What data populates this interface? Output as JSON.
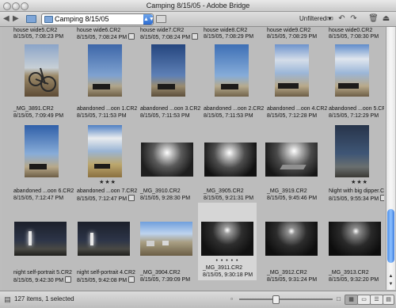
{
  "window": {
    "title": "Camping 8/15/05 - Adobe Bridge"
  },
  "toolbar": {
    "back_icon": "back-arrow-icon",
    "forward_icon": "forward-arrow-icon",
    "folder_path": "Camping 8/15/05",
    "filter_label": "Unfiltered"
  },
  "content": {
    "top_row_partial": [
      {
        "name": "house wide5.CR2",
        "date": "8/15/05, 7:08:23 PM",
        "badge": false
      },
      {
        "name": "house wide6.CR2",
        "date": "8/15/05, 7:08:24 PM",
        "badge": true
      },
      {
        "name": "house wide7.CR2",
        "date": "8/15/05, 7:08:24 PM",
        "badge": true
      },
      {
        "name": "house wide8.CR2",
        "date": "8/15/05, 7:08:29 PM",
        "badge": false
      },
      {
        "name": "house wide9.CR2",
        "date": "8/15/05, 7:08:29 PM",
        "badge": false
      },
      {
        "name": "house wide0.CR2",
        "date": "8/15/05, 7:08:30 PM",
        "badge": false
      }
    ],
    "row2": [
      {
        "name": "_MG_3891.CR2",
        "date": "8/15/05, 7:09:49 PM",
        "badge": false,
        "stars": ""
      },
      {
        "name": "abandoned ...oon 1.CR2",
        "date": "8/15/05, 7:11:53 PM",
        "badge": false,
        "stars": ""
      },
      {
        "name": "abandoned ...oon 3.CR2",
        "date": "8/15/05, 7:11:53 PM",
        "badge": false,
        "stars": ""
      },
      {
        "name": "abandoned ...oon 2.CR2",
        "date": "8/15/05, 7:11:53 PM",
        "badge": false,
        "stars": ""
      },
      {
        "name": "abandoned ...oon 4.CR2",
        "date": "8/15/05, 7:12:28 PM",
        "badge": false,
        "stars": ""
      },
      {
        "name": "abandoned ...oon 5.CR2",
        "date": "8/15/05, 7:12:29 PM",
        "badge": false,
        "stars": ""
      }
    ],
    "row3": [
      {
        "name": "abandoned ...oon 6.CR2",
        "date": "8/15/05, 7:12:47 PM",
        "badge": false,
        "stars": ""
      },
      {
        "name": "abandoned ...oon 7.CR2",
        "date": "8/15/05, 7:12:47 PM",
        "badge": true,
        "stars": "★★★"
      },
      {
        "name": "_MG_3910.CR2",
        "date": "8/15/05, 9:28:30 PM",
        "badge": false,
        "stars": ""
      },
      {
        "name": "_MG_3905.CR2",
        "date": "8/15/05, 9:21:31 PM",
        "badge": false,
        "stars": ""
      },
      {
        "name": "_MG_3919.CR2",
        "date": "8/15/05, 9:45:46 PM",
        "badge": false,
        "stars": ""
      },
      {
        "name": "Night with big dipper.CR2",
        "date": "8/15/05, 9:55:34 PM",
        "badge": true,
        "stars": "★★★"
      }
    ],
    "row4": [
      {
        "name": "night self-portrait 5.CR2",
        "date": "8/15/05, 9:42:30 PM",
        "badge": true,
        "stars": ""
      },
      {
        "name": "night self-portrait 4.CR2",
        "date": "8/15/05, 9:42:08 PM",
        "badge": true,
        "stars": ""
      },
      {
        "name": "_MG_3904.CR2",
        "date": "8/15/05, 7:39:09 PM",
        "badge": false,
        "stars": ""
      },
      {
        "name": "_MG_3911.CR2",
        "date": "8/15/05, 9:30:18 PM",
        "badge": false,
        "stars": "• • • • •"
      },
      {
        "name": "_MG_3912.CR2",
        "date": "8/15/05, 9:31:24 PM",
        "badge": false,
        "stars": ""
      },
      {
        "name": "_MG_3913.CR2",
        "date": "8/15/05, 9:32:20 PM",
        "badge": false,
        "stars": ""
      }
    ]
  },
  "status": {
    "text": "127 items, 1 selected"
  },
  "colors": {
    "accent": "#3f7ede",
    "background": "#bcbcbc"
  }
}
